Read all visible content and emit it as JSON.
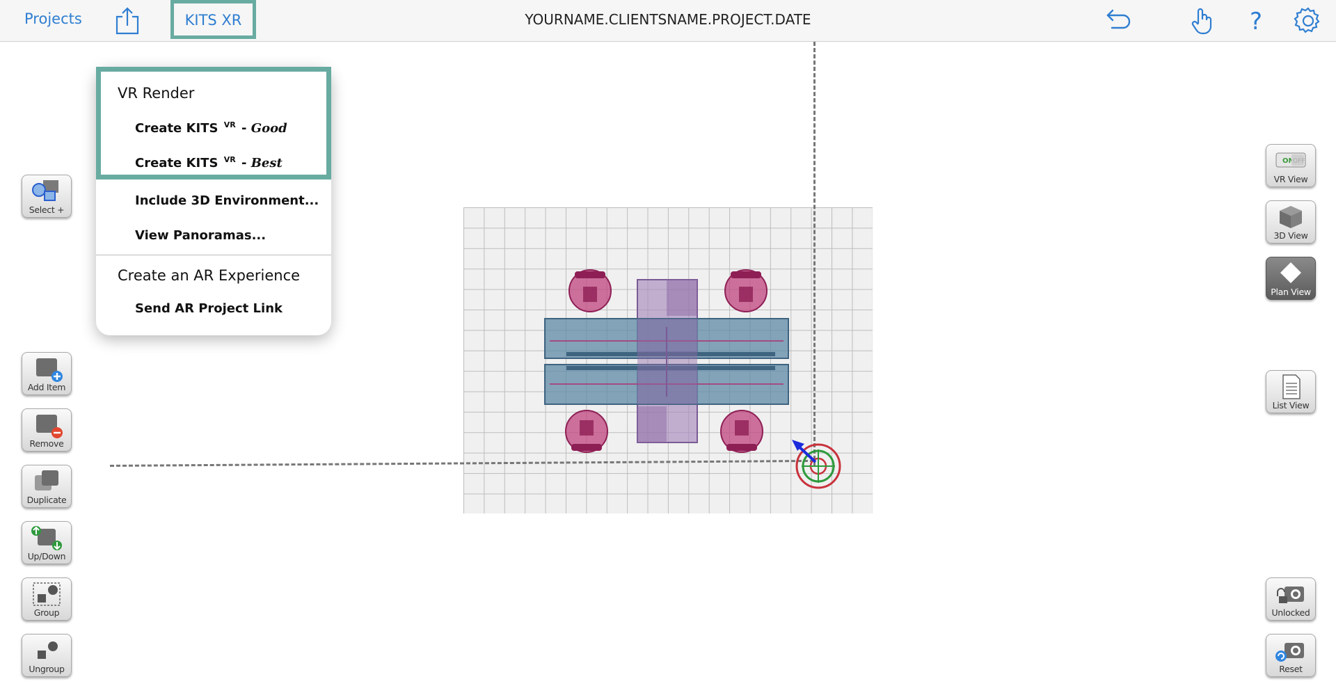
{
  "topbar": {
    "projects_label": "Projects",
    "kits_tab_label": "KITS XR",
    "title": "YOURNAME.CLIENTSNAME.PROJECT.DATE",
    "icons": [
      "share-icon",
      "undo-icon",
      "hand-pointer-icon",
      "help-icon",
      "settings-gear-icon"
    ]
  },
  "menu": {
    "vr_heading": "VR Render",
    "create_good": {
      "prefix": "Create KITS",
      "sup": "VR",
      "sep": "- ",
      "quality": "Good"
    },
    "create_best": {
      "prefix": "Create KITS",
      "sup": "VR",
      "sep": "- ",
      "quality": "Best"
    },
    "include_env": "Include 3D Environment...",
    "view_panoramas": "View Panoramas...",
    "ar_heading": "Create an AR Experience",
    "send_ar_link": "Send AR Project Link"
  },
  "left_tools": {
    "select": "Select +",
    "add_item": "Add Item",
    "remove": "Remove",
    "duplicate": "Duplicate",
    "up_down": "Up/Down",
    "group": "Group",
    "ungroup": "Ungroup"
  },
  "right_tools": {
    "vr_view": "VR View",
    "vr_toggle_on": "ON",
    "vr_toggle_off": "OFF",
    "view_3d": "3D View",
    "plan_view": "Plan View",
    "list_view": "List View",
    "unlocked": "Unlocked",
    "reset": "Reset"
  },
  "colors": {
    "accent_blue": "#2f7ed1",
    "highlight_teal": "#68aba1",
    "chair_magenta": "#b0306f",
    "table_slate": "#5d8aa6",
    "purple_block": "#9a79b0"
  }
}
